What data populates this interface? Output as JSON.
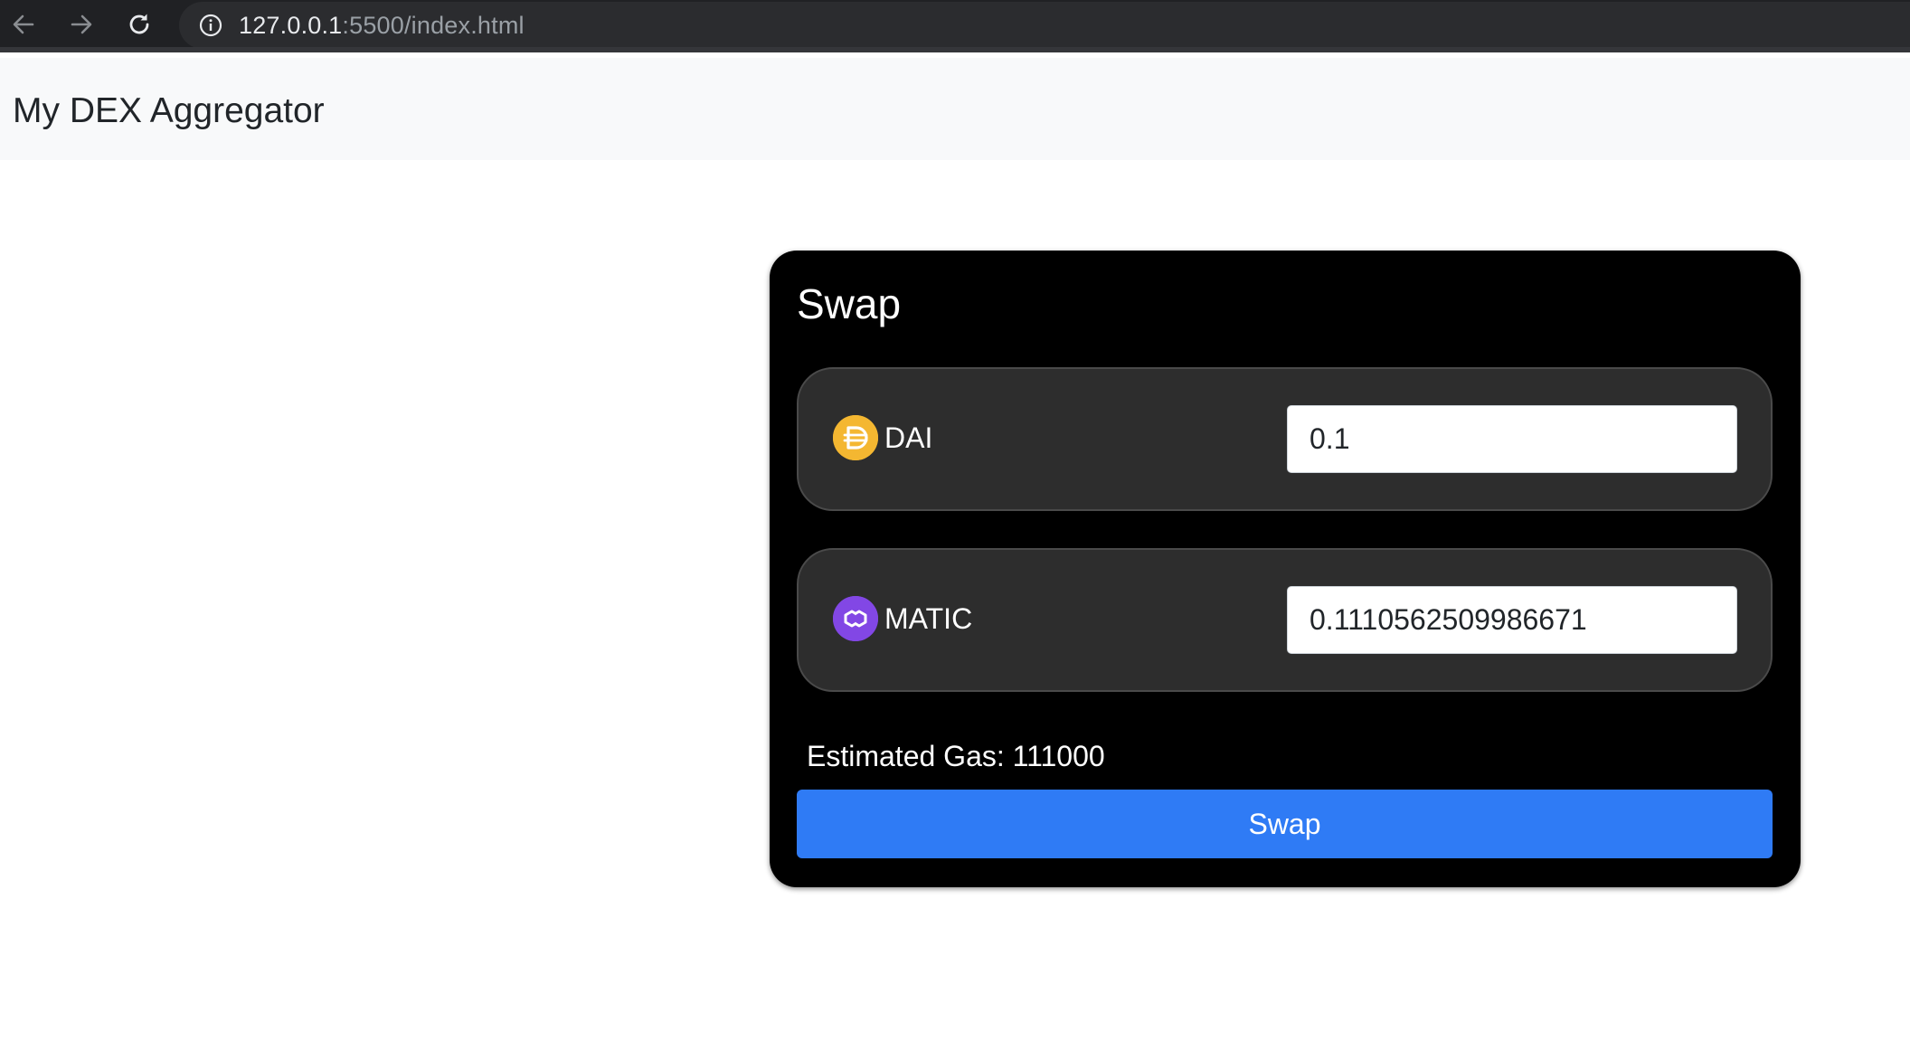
{
  "browser": {
    "url_host": "127.0.0.1",
    "url_path": ":5500/index.html"
  },
  "navbar": {
    "brand": "My DEX Aggregator"
  },
  "swap": {
    "title": "Swap",
    "from_token": {
      "symbol": "DAI",
      "icon": "dai-logo-icon",
      "icon_color": "#f4b731",
      "amount": "0.1"
    },
    "to_token": {
      "symbol": "MATIC",
      "icon": "matic-logo-icon",
      "icon_color": "#8247e5",
      "amount": "0.1110562509986671"
    },
    "estimated_gas": "Estimated Gas: 111000",
    "button_label": "Swap"
  },
  "colors": {
    "card_background": "#000000",
    "token_row_background": "#2d2d2d",
    "swap_button": "#2f7bf5",
    "navbar_background": "#f8f9fa"
  }
}
